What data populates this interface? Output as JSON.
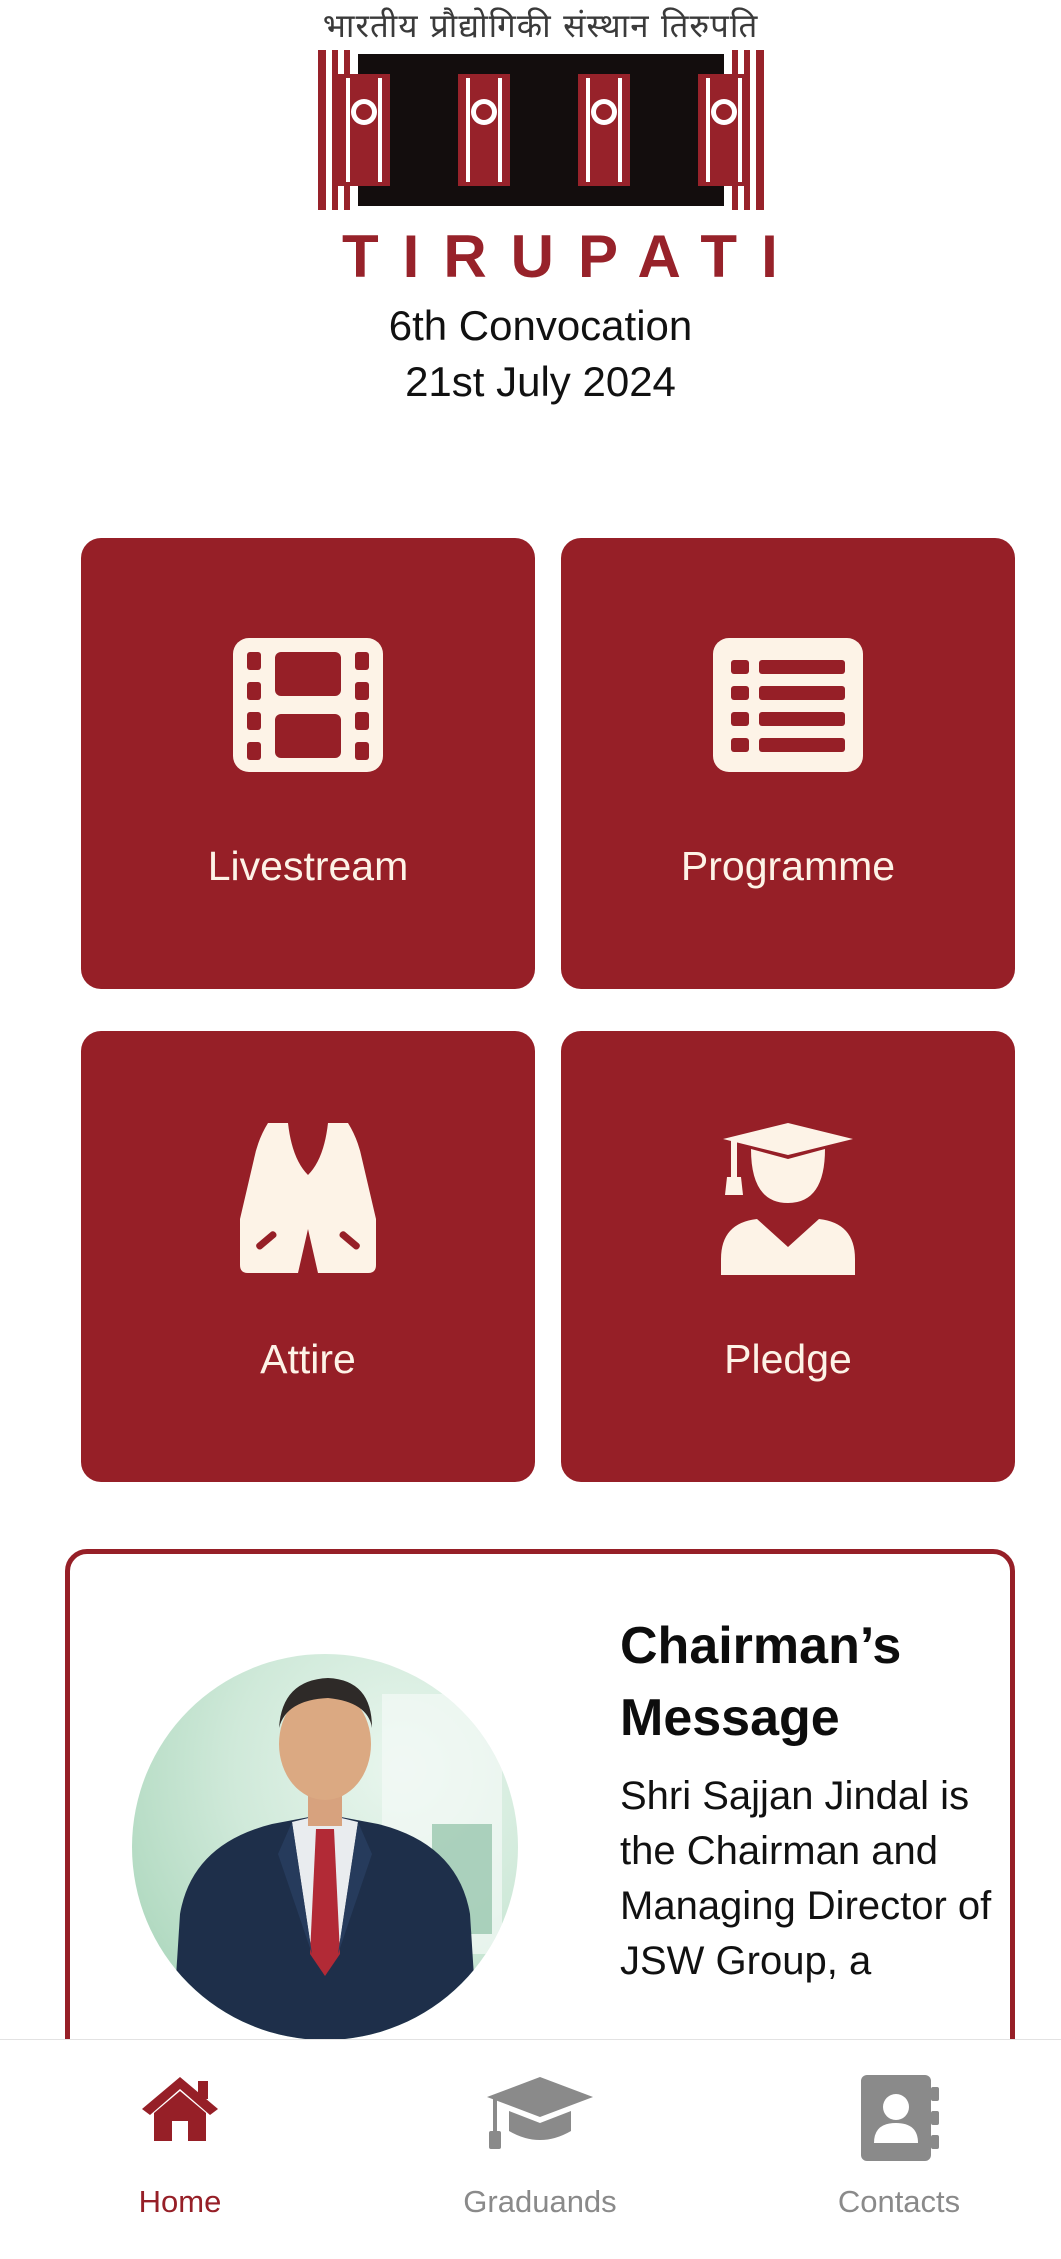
{
  "header": {
    "logo_hindi": "भारतीय प्रौद्योगिकी संस्थान तिरुपति",
    "logo_word": "TIRUPATI",
    "event_title": "6th Convocation",
    "event_date": "21st July 2024"
  },
  "tiles": [
    {
      "label": "Livestream",
      "icon": "film-icon"
    },
    {
      "label": "Programme",
      "icon": "list-icon"
    },
    {
      "label": "Attire",
      "icon": "vest-icon"
    },
    {
      "label": "Pledge",
      "icon": "graduate-icon"
    }
  ],
  "chairman_card": {
    "title": "Chairman’s Message",
    "body": "Shri Sajjan Jindal is the Chairman and Managing Director of JSW Group, a"
  },
  "bottom_nav": {
    "items": [
      {
        "label": "Home",
        "icon": "home-icon",
        "active": true
      },
      {
        "label": "Graduands",
        "icon": "graduation-cap-icon",
        "active": false
      },
      {
        "label": "Contacts",
        "icon": "contact-book-icon",
        "active": false
      }
    ]
  },
  "colors": {
    "brand": "#961f27",
    "tile_icon": "#fdf3e7",
    "inactive_nav": "#8a8a8a"
  }
}
